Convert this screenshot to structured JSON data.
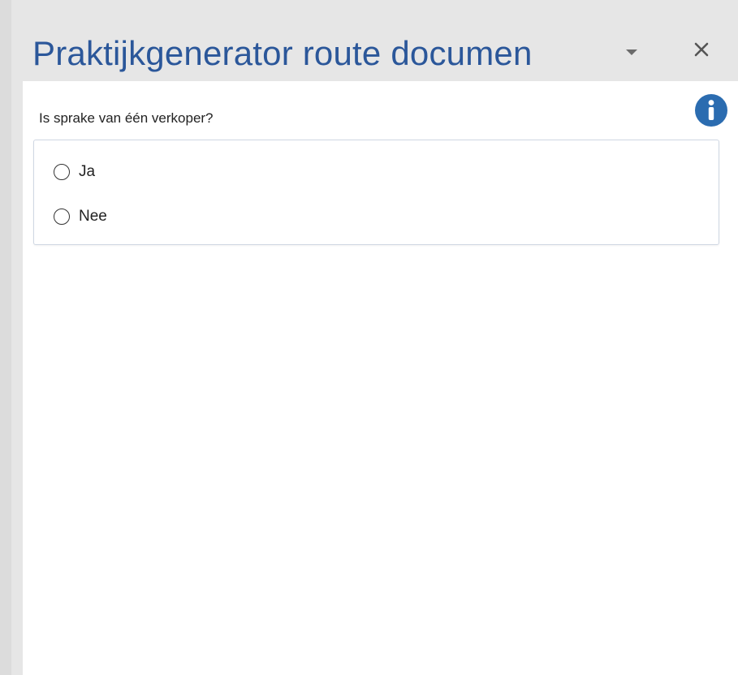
{
  "pane": {
    "title": "Praktijkgenerator route documen",
    "accent_color": "#2b579a",
    "menu_icon": "triangle-down-icon",
    "close_icon": "close-icon"
  },
  "form": {
    "question": "Is sprake van één verkoper?",
    "info_icon": "info-icon",
    "info_color": "#2b6cb0",
    "options": [
      {
        "label": "Ja",
        "selected": false
      },
      {
        "label": "Nee",
        "selected": false
      }
    ]
  }
}
